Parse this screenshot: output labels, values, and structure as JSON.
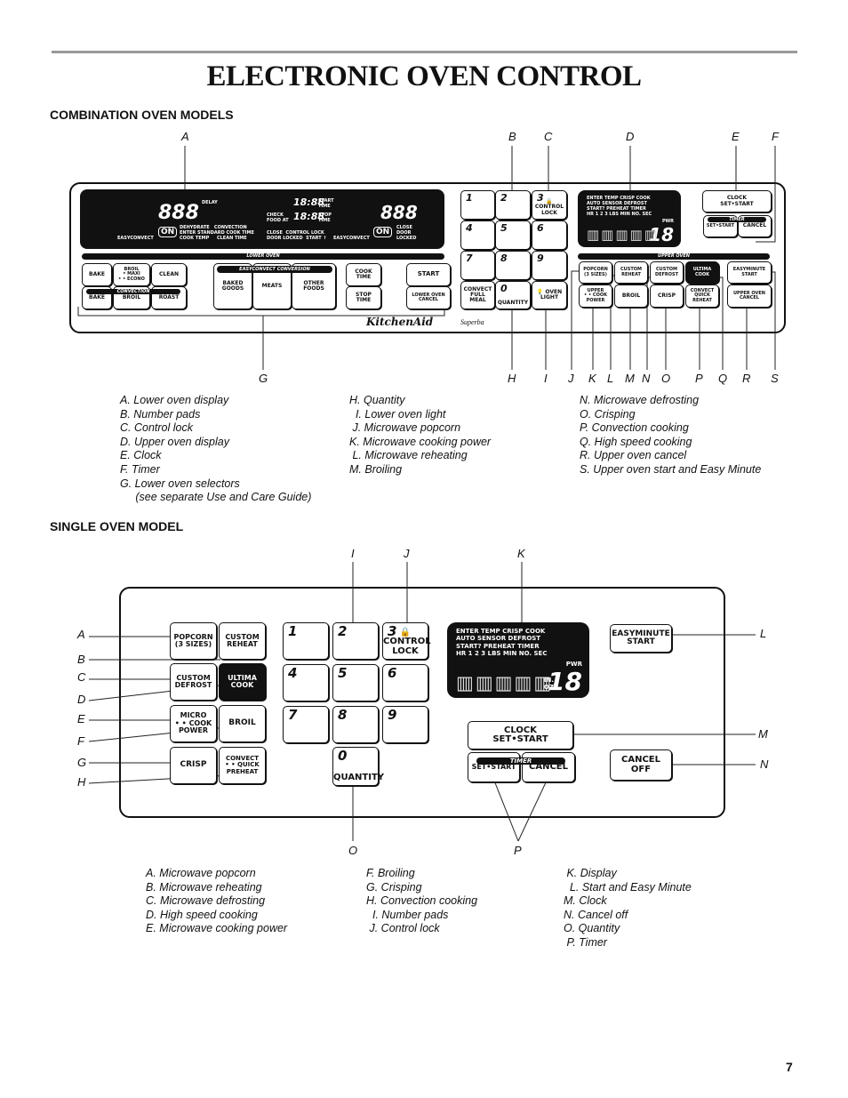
{
  "title": "ELECTRONIC OVEN CONTROL",
  "page_number": "7",
  "combo": {
    "heading": "COMBINATION OVEN MODELS",
    "callouts_top": [
      "A",
      "B",
      "C",
      "D",
      "E",
      "F"
    ],
    "callouts_bottom": [
      "G",
      "H",
      "I",
      "J",
      "K",
      "L",
      "M",
      "N",
      "O",
      "P",
      "Q",
      "R",
      "S"
    ],
    "lower_display": {
      "convect": "EASYCONVECT",
      "temp": "888",
      "unit": "°F",
      "on": "ON",
      "delay": "DELAY",
      "modes": "DEHYDRATE   CONVECTION\nENTER STANDARD COOK TIME\nCOOK TEMP     CLEAN TIME",
      "time1": "18:88",
      "time2": "18:88",
      "start_time": "START TIME",
      "stop_time": "STOP TIME",
      "check": "CHECK FOOD AT",
      "status": "CLOSE  CONTROL LOCK\nDOOR LOCKED  START ↑",
      "door": "CLOSE\nDOOR\nLOCKED"
    },
    "upper_display": {
      "words": "ENTER TEMP CRISP COOK\nAUTO SENSOR DEFROST\nSTART? PREHEAT TIMER\nHR 1 2 3 LBS MIN NO. SEC",
      "pwr": "PWR",
      "digits": "18"
    },
    "lower_oven_bar": "LOWER OVEN",
    "convection_bar": "CONVECTION",
    "easyconvect_bar": "EASYCONVECT CONVERSION",
    "upper_oven_bar": "UPPER OVEN",
    "timer_bar": "TIMER",
    "brand": "KitchenAid",
    "model": "Superba",
    "buttons": [
      {
        "label": "BAKE"
      },
      {
        "label": "BROIL\n• MAXI\n• • ECONO"
      },
      {
        "label": "CLEAN"
      },
      {
        "label": "BAKE"
      },
      {
        "label": "BROIL"
      },
      {
        "label": "ROAST"
      },
      {
        "label": "BAKED\nGOODS"
      },
      {
        "label": "MEATS"
      },
      {
        "label": "OTHER\nFOODS"
      },
      {
        "label": "COOK\nTIME"
      },
      {
        "label": "STOP\nTIME"
      },
      {
        "label": "START"
      },
      {
        "label": "LOWER OVEN\nCANCEL"
      },
      {
        "label": "1"
      },
      {
        "label": "2"
      },
      {
        "label": "3",
        "sub": "🔒 CONTROL LOCK"
      },
      {
        "label": "4"
      },
      {
        "label": "5"
      },
      {
        "label": "6"
      },
      {
        "label": "7"
      },
      {
        "label": "8"
      },
      {
        "label": "9"
      },
      {
        "label": "CONVECT\nFULL\nMEAL"
      },
      {
        "label": "0",
        "sub": "QUANTITY"
      },
      {
        "label": "💡 OVEN\nLIGHT"
      },
      {
        "label": "POPCORN\n(3 SIZES)"
      },
      {
        "label": "CUSTOM\nREHEAT"
      },
      {
        "label": "CUSTOM\nDEFROST"
      },
      {
        "label": "ULTIMA\nCOOK"
      },
      {
        "label": "UPPER\n• • COOK POWER"
      },
      {
        "label": "BROIL"
      },
      {
        "label": "CRISP"
      },
      {
        "label": "CONVECT\nQUICK\nREHEAT"
      },
      {
        "label": "EASYMINUTE\nSTART"
      },
      {
        "label": "UPPER OVEN\nCANCEL"
      },
      {
        "label": "CLOCK\nSET•START"
      },
      {
        "label": "SET•START"
      },
      {
        "label": "CANCEL"
      }
    ],
    "legend": [
      "A. Lower oven display\nB. Number pads\nC. Control lock\nD. Upper oven display\nE. Clock\nF. Timer\nG. Lower oven selectors\n     (see separate Use and Care Guide)",
      "H. Quantity\n  I. Lower oven light\n J. Microwave popcorn\nK. Microwave cooking power\n L. Microwave reheating\nM. Broiling",
      "N. Microwave defrosting\nO. Crisping\nP. Convection cooking\nQ. High speed cooking\nR. Upper oven cancel\nS. Upper oven start and Easy Minute"
    ]
  },
  "single": {
    "heading": "SINGLE OVEN MODEL",
    "callouts": [
      "A",
      "B",
      "C",
      "D",
      "E",
      "F",
      "G",
      "H",
      "I",
      "J",
      "K",
      "L",
      "M",
      "N",
      "O",
      "P"
    ],
    "display": {
      "words": "ENTER TEMP CRISP COOK\nAUTO SENSOR DEFROST\nSTART? PREHEAT TIMER\nHR 1 2 3 LBS MIN NO. SEC",
      "pwr": "PWR",
      "digits": "18",
      "units": "IN.\nOZ"
    },
    "timer_bar": "TIMER",
    "buttons": [
      {
        "label": "POPCORN\n(3 SIZES)"
      },
      {
        "label": "CUSTOM\nREHEAT"
      },
      {
        "label": "CUSTOM\nDEFROST"
      },
      {
        "label": "ULTIMA\nCOOK"
      },
      {
        "label": "MICRO\n• • COOK\nPOWER"
      },
      {
        "label": "BROIL"
      },
      {
        "label": "CRISP"
      },
      {
        "label": "CONVECT\n• • QUICK\nPREHEAT"
      },
      {
        "label": "1"
      },
      {
        "label": "2"
      },
      {
        "label": "3",
        "sub": "🔒 CONTROL LOCK"
      },
      {
        "label": "4"
      },
      {
        "label": "5"
      },
      {
        "label": "6"
      },
      {
        "label": "7"
      },
      {
        "label": "8"
      },
      {
        "label": "9"
      },
      {
        "label": "0",
        "sub": "QUANTITY"
      },
      {
        "label": "EASYMINUTE\nSTART"
      },
      {
        "label": "CLOCK\nSET•START"
      },
      {
        "label": "SET•START"
      },
      {
        "label": "CANCEL"
      },
      {
        "label": "CANCEL\nOFF"
      }
    ],
    "legend": [
      "A. Microwave popcorn\nB. Microwave reheating\nC. Microwave defrosting\nD. High speed cooking\nE. Microwave cooking power",
      "F. Broiling\nG. Crisping\nH. Convection cooking\n  I. Number pads\n J. Control lock",
      " K. Display\n  L. Start and Easy Minute\nM. Clock\nN. Cancel off\nO. Quantity\n P. Timer"
    ]
  }
}
